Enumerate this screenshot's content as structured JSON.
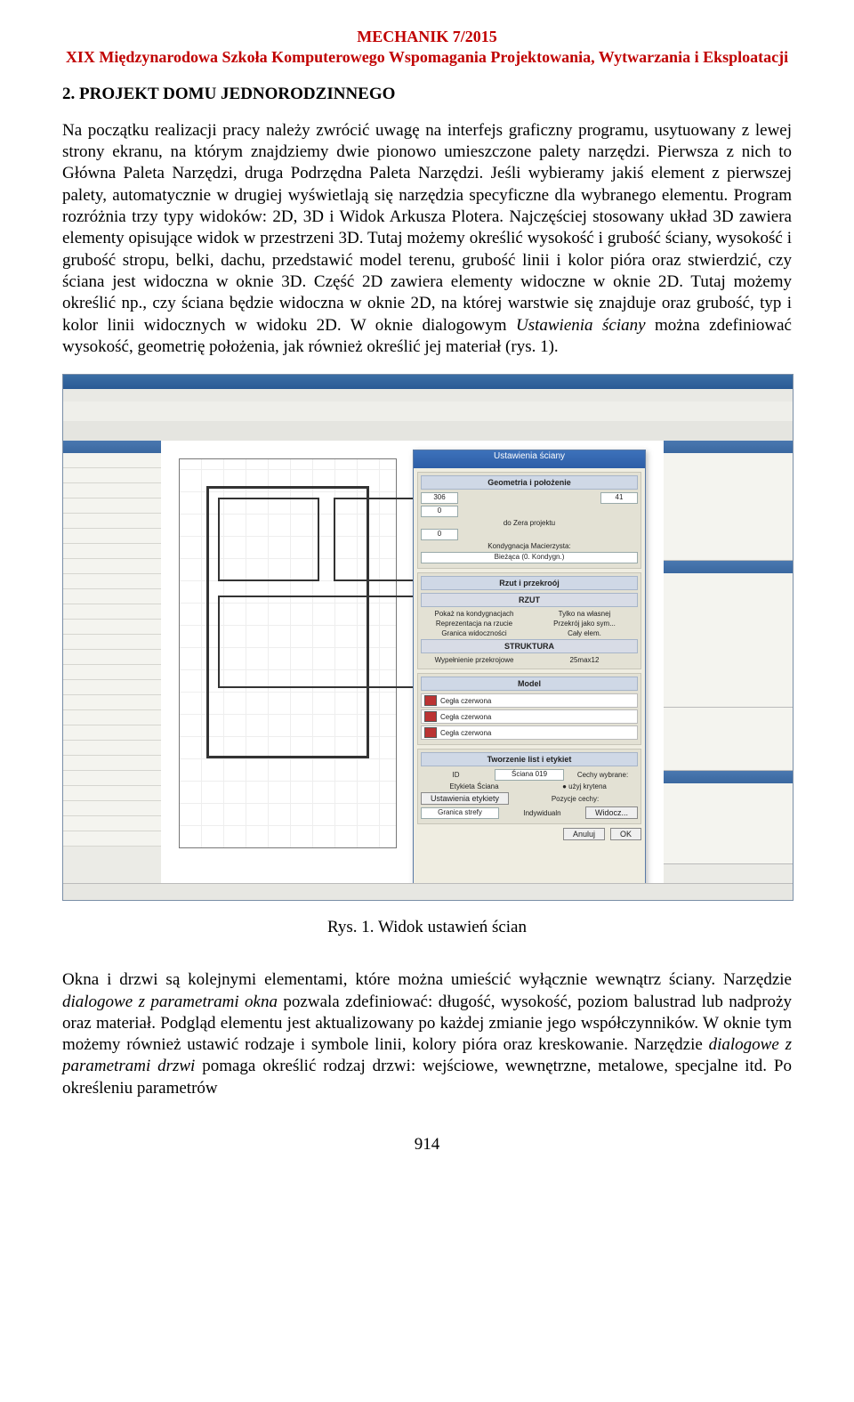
{
  "header": {
    "line1": "MECHANIK 7/2015",
    "line2": "XIX Międzynarodowa Szkoła Komputerowego Wspomagania Projektowania, Wytwarzania i Eksploatacji"
  },
  "section_title": "2. PROJEKT DOMU JEDNORODZINNEGO",
  "paragraph1_a": "Na początku realizacji pracy należy zwrócić uwagę na interfejs graficzny programu, usytuowany z lewej strony ekranu, na którym znajdziemy dwie pionowo umieszczone palety narzędzi. Pierwsza z nich to Główna Paleta Narzędzi, druga Podrzędna Paleta Narzędzi. Jeśli wybieramy jakiś element z pierwszej palety, automatycznie w drugiej wyświetlają się narzędzia specyficzne dla wybranego elementu. Program rozróżnia trzy typy widoków: 2D, 3D i Widok Arkusza Plotera. Najczęściej stosowany układ 3D zawiera elementy opisujące widok w przestrzeni 3D. Tutaj możemy określić wysokość i grubość ściany, wysokość i grubość stropu, belki, dachu, przedstawić model terenu, grubość linii i kolor pióra oraz stwierdzić, czy ściana jest widoczna w oknie 3D. Część 2D zawiera elementy widoczne w oknie 2D. Tutaj możemy określić np., czy ściana będzie widoczna w oknie 2D, na której warstwie się znajduje oraz grubość, typ i kolor linii widocznych w widoku 2D. W oknie dialogowym ",
  "paragraph1_i": "Ustawienia ściany",
  "paragraph1_b": " można zdefiniować wysokość, geometrię położenia, jak również określić jej materiał (rys. 1).",
  "figure": {
    "dialog_title": "Ustawienia ściany",
    "geom_header": "Geometria i położenie",
    "val_h": "306",
    "val_t": "41",
    "val_z": "0",
    "lbl_zera": "do Zera projektu",
    "val_zero": "0",
    "lbl_kond": "Kondygnacja Macierzysta:",
    "val_kond": "Bieżąca (0. Kondygn.)",
    "sect_rzut": "Rzut i przekroój",
    "sect_rzut_h": "RZUT",
    "row_r1a": "Pokaż na kondygnacjach",
    "row_r1b": "Tylko na własnej",
    "row_r2a": "Reprezentacja na rzucie",
    "row_r2b": "Przekrój jako sym...",
    "row_r3a": "Granica widoczności",
    "row_r3b": "Cały elem.",
    "sect_struct_h": "STRUKTURA",
    "row_s1a": "Wypełnienie przekrojowe",
    "row_s1b": "25max12",
    "sect_model": "Model",
    "mat": "Cegła czerwona",
    "sect_list": "Tworzenie list i etykiet",
    "lbl_id": "ID",
    "val_id": "Ściana 019",
    "lbl_etyk": "Etykieta Ściana",
    "btn_uetyk": "Ustawienia etykiety",
    "lbl_gran": "Granica strefy",
    "lbl_cechy": "Cechy wybrane:",
    "row_c1": "● użyj krytena",
    "lbl_poz": "Pozycje cechy:",
    "chk_ind": "Indywidualn",
    "btn_wid": "Widocz...",
    "btn_anuluj": "Anuluj",
    "btn_ok": "OK"
  },
  "caption": "Rys. 1. Widok ustawień ścian",
  "paragraph2_a": "Okna i drzwi są kolejnymi elementami, które można umieścić wyłącznie wewnątrz ściany. Narzędzie ",
  "paragraph2_i1": "dialogowe z parametrami okna",
  "paragraph2_b": " pozwala zdefiniować: długość, wysokość, poziom balustrad lub nadproży oraz materiał. Podgląd elementu jest aktualizowany po każdej zmianie jego współczynników. W oknie tym możemy również ustawić rodzaje i symbole linii, kolory pióra oraz kreskowanie. Narzędzie ",
  "paragraph2_i2": "dialogowe z parametrami drzwi",
  "paragraph2_c": " pomaga określić rodzaj drzwi: wejściowe, wewnętrzne, metalowe, specjalne itd. Po określeniu parametrów",
  "page_number": "914"
}
